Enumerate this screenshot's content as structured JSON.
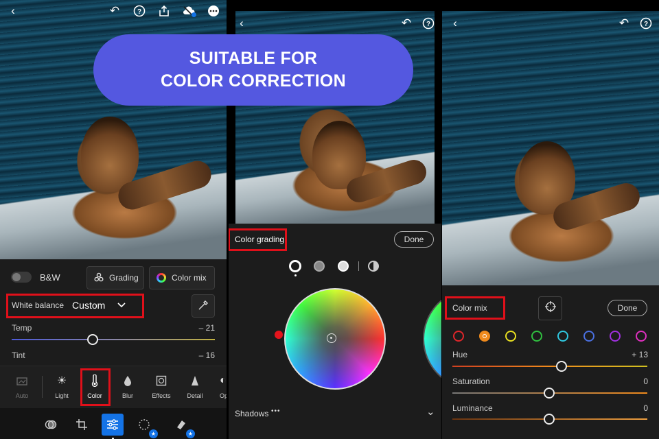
{
  "banner": {
    "line1": "SUITABLE FOR",
    "line2": "COLOR CORRECTION",
    "color": "#5458e0"
  },
  "panel1": {
    "top_icons": [
      "back-icon",
      "undo-icon",
      "help-icon",
      "share-icon",
      "cloud-sync-icon",
      "more-icon"
    ],
    "bw_label": "B&W",
    "grading_label": "Grading",
    "color_mix_label": "Color mix",
    "white_balance_label": "White balance",
    "white_balance_value": "Custom",
    "temp_label": "Temp",
    "temp_value": "– 21",
    "tint_label": "Tint",
    "tint_value": "– 16",
    "tools": [
      {
        "label": "Auto",
        "icon": "auto-icon"
      },
      {
        "label": "Light",
        "icon": "sun-icon"
      },
      {
        "label": "Color",
        "icon": "thermometer-icon"
      },
      {
        "label": "Blur",
        "icon": "drop-icon"
      },
      {
        "label": "Effects",
        "icon": "effects-icon"
      },
      {
        "label": "Detail",
        "icon": "triangle-icon"
      },
      {
        "label": "Op",
        "icon": "optics-icon"
      }
    ],
    "bottom_nav": [
      "presets-icon",
      "crop-icon",
      "edit-icon",
      "selective-icon",
      "healing-icon"
    ],
    "highlight_color": "#e0101a",
    "active_color": "#1473e6"
  },
  "panel2": {
    "title": "Color grading",
    "done_label": "Done",
    "modes": [
      "shadows-mode-icon",
      "midtones-mode-icon",
      "highlights-mode-icon",
      "global-mode-icon"
    ],
    "shadows_label": "Shadows",
    "more_glyph": "•••",
    "chevron_glyph": "⌄"
  },
  "panel3": {
    "title": "Color mix",
    "done_label": "Done",
    "colors": [
      "#e0262a",
      "#f08a1c",
      "#e8e020",
      "#30c040",
      "#30c8e0",
      "#4a70e0",
      "#a030e0",
      "#e030c0"
    ],
    "hue_label": "Hue",
    "hue_value": "+ 13",
    "saturation_label": "Saturation",
    "saturation_value": "0",
    "luminance_label": "Luminance",
    "luminance_value": "0"
  }
}
